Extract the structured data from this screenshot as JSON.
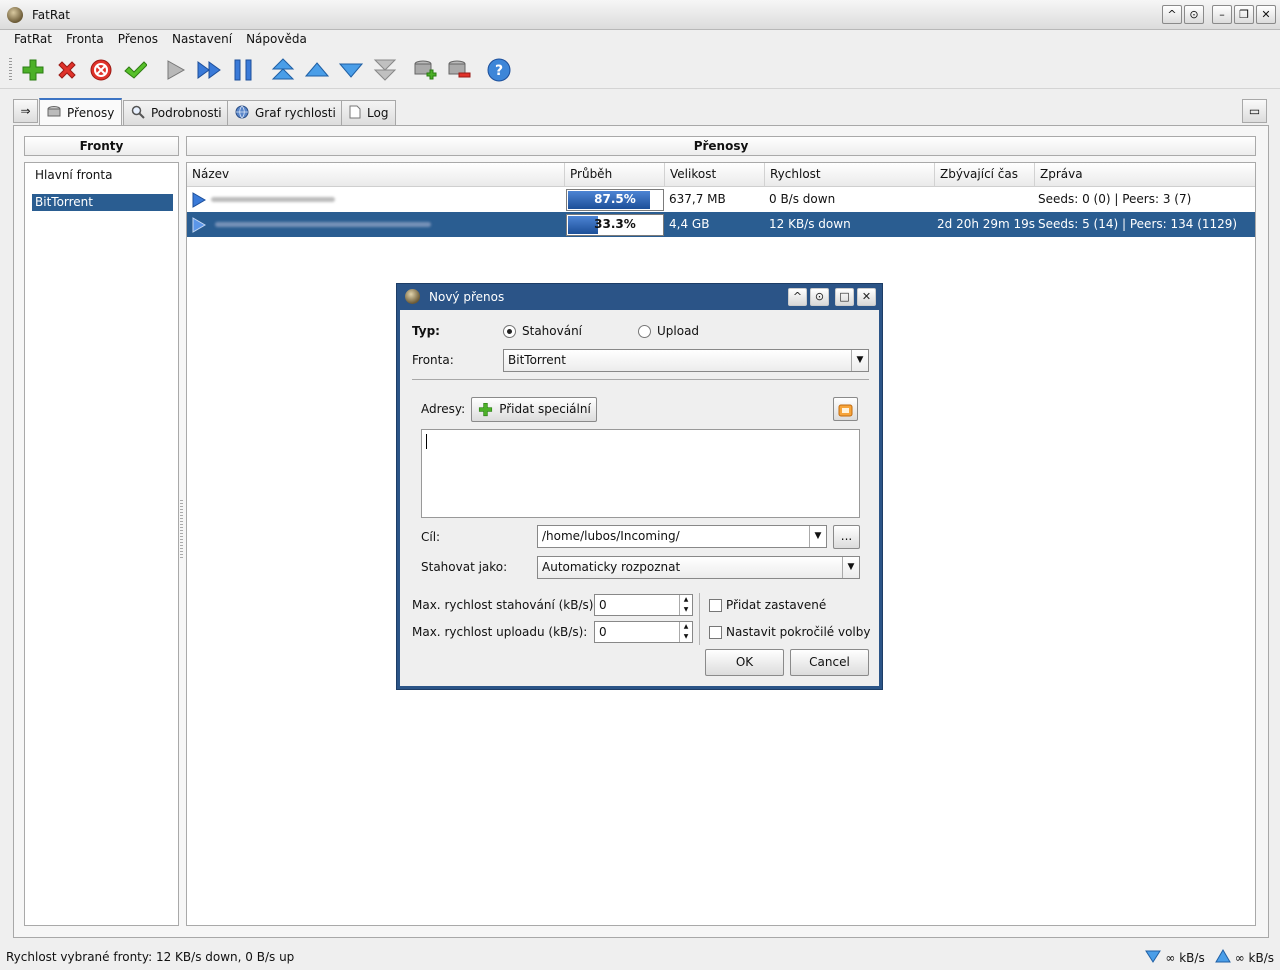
{
  "window": {
    "title": "FatRat",
    "controls": [
      "^",
      "⊙",
      "–",
      "❐",
      "✕"
    ]
  },
  "menu": [
    "FatRat",
    "Fronta",
    "Přenos",
    "Nastavení",
    "Nápověda"
  ],
  "toolbar": {
    "icons": [
      "add-icon",
      "delete-icon",
      "delete-with-data-icon",
      "resume-all-icon",
      "resume-icon",
      "force-resume-icon",
      "pause-icon",
      "move-top-icon",
      "move-up-icon",
      "move-down-icon",
      "move-bottom-icon",
      "add-queue-icon",
      "remove-queue-icon",
      "help-icon"
    ]
  },
  "tabs": {
    "items": [
      {
        "label": "Přenosy",
        "icon": "transfers-icon"
      },
      {
        "label": "Podrobnosti",
        "icon": "magnifier-icon"
      },
      {
        "label": "Graf rychlosti",
        "icon": "globe-icon"
      },
      {
        "label": "Log",
        "icon": "document-icon"
      }
    ]
  },
  "queues": {
    "header": "Fronty",
    "items": [
      "Hlavní fronta",
      "BitTorrent"
    ],
    "selected_index": 1
  },
  "transfers": {
    "header": "Přenosy",
    "columns": [
      "Název",
      "Průběh",
      "Velikost",
      "Rychlost",
      "Zbývající čas",
      "Zpráva"
    ],
    "rows": [
      {
        "name": "",
        "progress": 87.5,
        "progress_label": "87.5%",
        "size": "637,7 MB",
        "speed": "0 B/s down",
        "eta": "",
        "message": "Seeds: 0 (0) | Peers: 3 (7)",
        "selected": false
      },
      {
        "name": "",
        "progress": 33.3,
        "progress_label": "33.3%",
        "size": "4,4 GB",
        "speed": "12 KB/s down",
        "eta": "2d 20h 29m 19s",
        "message": "Seeds: 5 (14) | Peers: 134 (1129)",
        "selected": true
      }
    ]
  },
  "dialog": {
    "title": "Nový přenos",
    "controls": [
      "^",
      "⊙",
      "□",
      "✕"
    ],
    "type_label": "Typ:",
    "type_options": [
      "Stahování",
      "Upload"
    ],
    "type_selected": "Stahování",
    "queue_label": "Fronta:",
    "queue_value": "BitTorrent",
    "addresses_label": "Adresy:",
    "add_special_label": "Přidat speciální",
    "addresses_value": "",
    "destination_label": "Cíl:",
    "destination_value": "/home/lubos/Incoming/",
    "browse_label": "...",
    "download_as_label": "Stahovat jako:",
    "download_as_value": "Automaticky rozpoznat",
    "max_down_label": "Max. rychlost stahování (kB/s):",
    "max_down_value": "0",
    "max_up_label": "Max. rychlost uploadu (kB/s):",
    "max_up_value": "0",
    "add_paused_label": "Přidat zastavené",
    "add_paused_checked": false,
    "advanced_label": "Nastavit pokročilé volby",
    "advanced_checked": false,
    "ok_label": "OK",
    "cancel_label": "Cancel"
  },
  "status": {
    "text": "Rychlost vybrané fronty: 12 KB/s down, 0 B/s up",
    "down_limit": "∞ kB/s",
    "up_limit": "∞ kB/s"
  },
  "colors": {
    "selection": "#2a5d91",
    "progress": "#2a62b5",
    "dialog_frame": "#2b5487"
  }
}
